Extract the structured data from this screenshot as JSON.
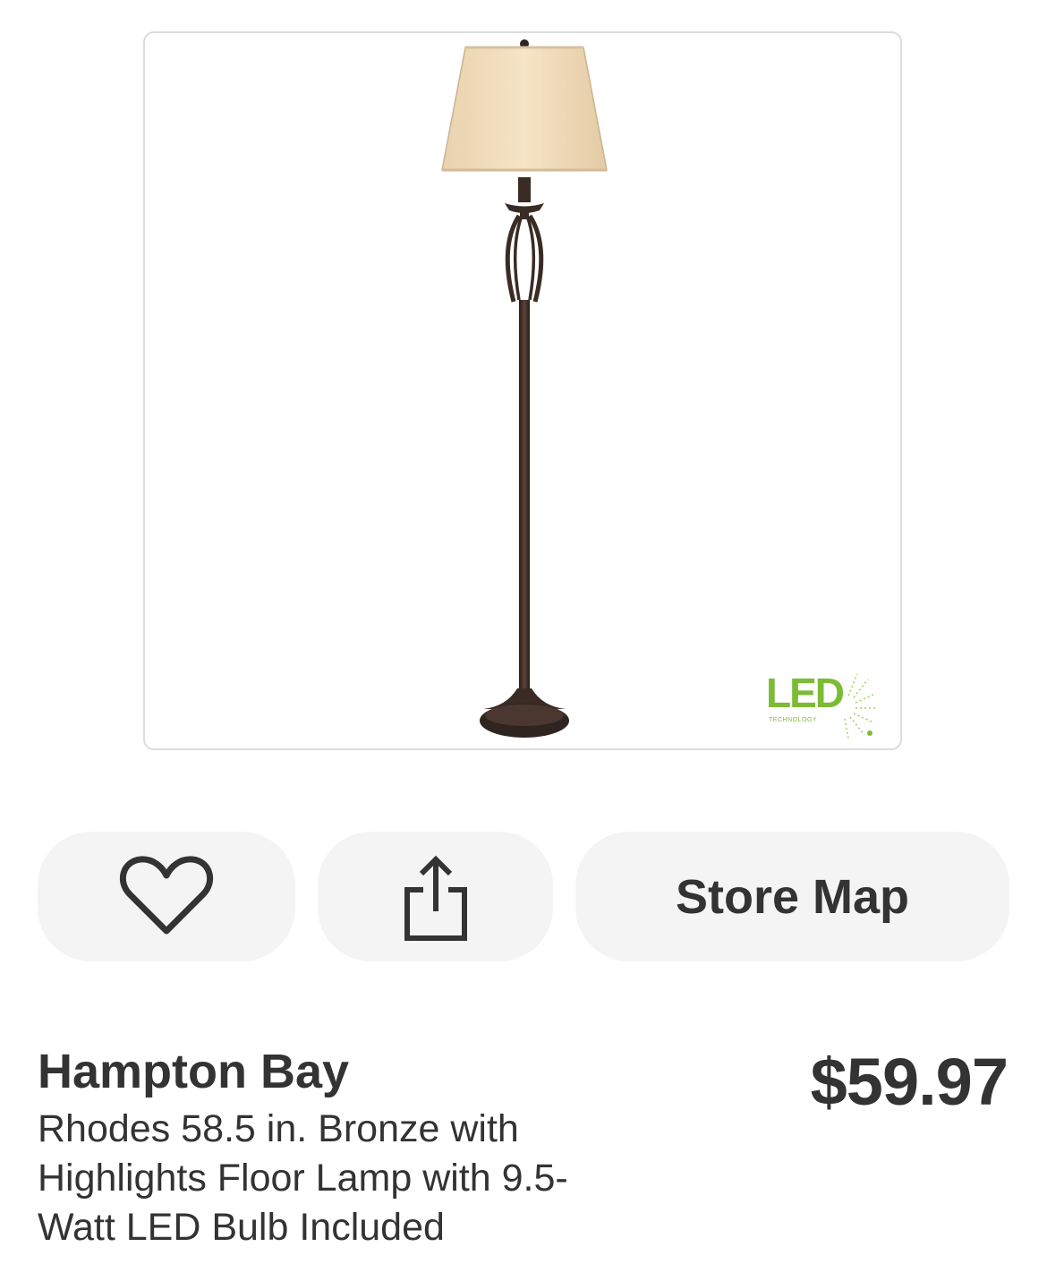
{
  "product_image": {
    "badge_text": "LED",
    "badge_subtext": "TECHNOLOGY",
    "badge_color": "#7cbb35"
  },
  "actions": {
    "favorite_icon": "heart-icon",
    "share_icon": "share-icon",
    "store_map_label": "Store Map"
  },
  "product": {
    "brand": "Hampton Bay",
    "description": "Rhodes 58.5 in. Bronze with Highlights Floor Lamp with 9.5-Watt LED Bulb Included",
    "price": "$59.97"
  },
  "colors": {
    "text": "#333333",
    "button_bg": "#f4f4f4",
    "frame_border": "#dcdcdc"
  }
}
